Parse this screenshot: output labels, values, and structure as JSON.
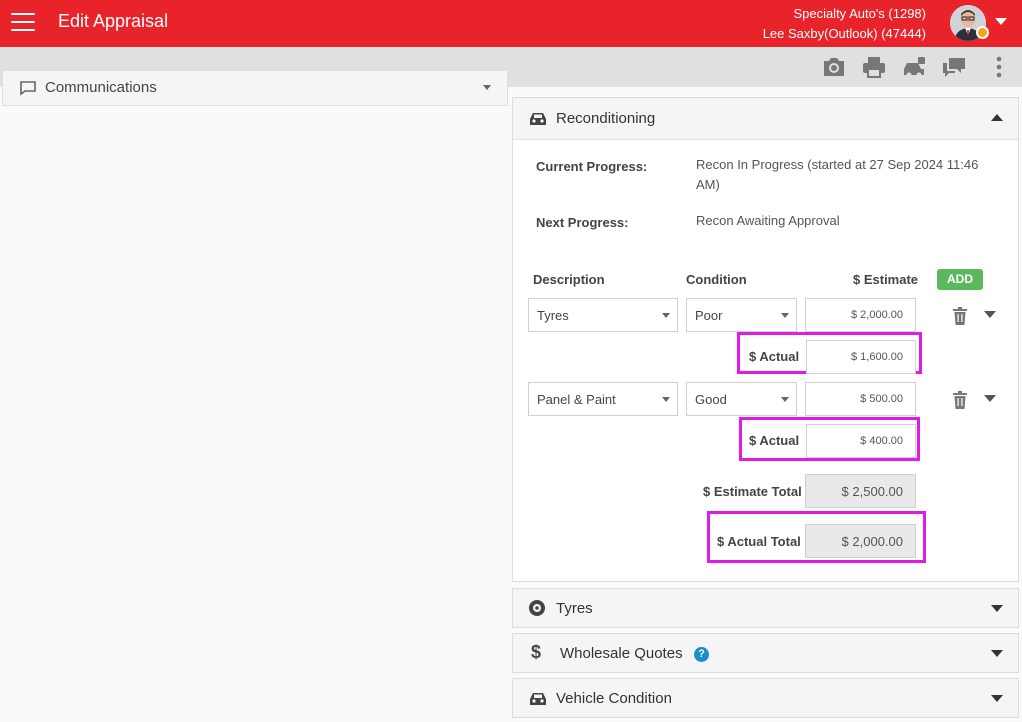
{
  "header": {
    "title": "Edit Appraisal",
    "dealer": "Specialty Auto's (1298)",
    "user": "Lee Saxby(Outlook) (47444)",
    "colors": {
      "brand": "#e8232a",
      "status": "#f7a21b"
    }
  },
  "toolbar": {
    "icons": [
      "camera-icon",
      "print-icon",
      "car-icon",
      "chat-icon",
      "more-vertical-icon"
    ]
  },
  "left": {
    "communications_label": "Communications"
  },
  "recon": {
    "title": "Reconditioning",
    "current_label": "Current Progress:",
    "current_value": "Recon In Progress (started at 27 Sep 2024 11:46 AM)",
    "next_label": "Next Progress:",
    "next_value": "Recon Awaiting Approval",
    "col_description": "Description",
    "col_condition": "Condition",
    "col_estimate": "$ Estimate",
    "add_label": "ADD",
    "actual_label": "$ Actual",
    "items": [
      {
        "description": "Tyres",
        "condition": "Poor",
        "estimate": "$ 2,000.00",
        "actual": "$ 1,600.00"
      },
      {
        "description": "Panel & Paint",
        "condition": "Good",
        "estimate": "$ 500.00",
        "actual": "$ 400.00"
      }
    ],
    "estimate_total_label": "$ Estimate Total",
    "estimate_total": "$ 2,500.00",
    "actual_total_label": "$ Actual Total",
    "actual_total": "$ 2,000.00",
    "highlight_color": "#e11ae8"
  },
  "sections": {
    "tyres": "Tyres",
    "wholesale": "Wholesale Quotes",
    "wholesale_help": "?",
    "vehicle_condition": "Vehicle Condition"
  }
}
